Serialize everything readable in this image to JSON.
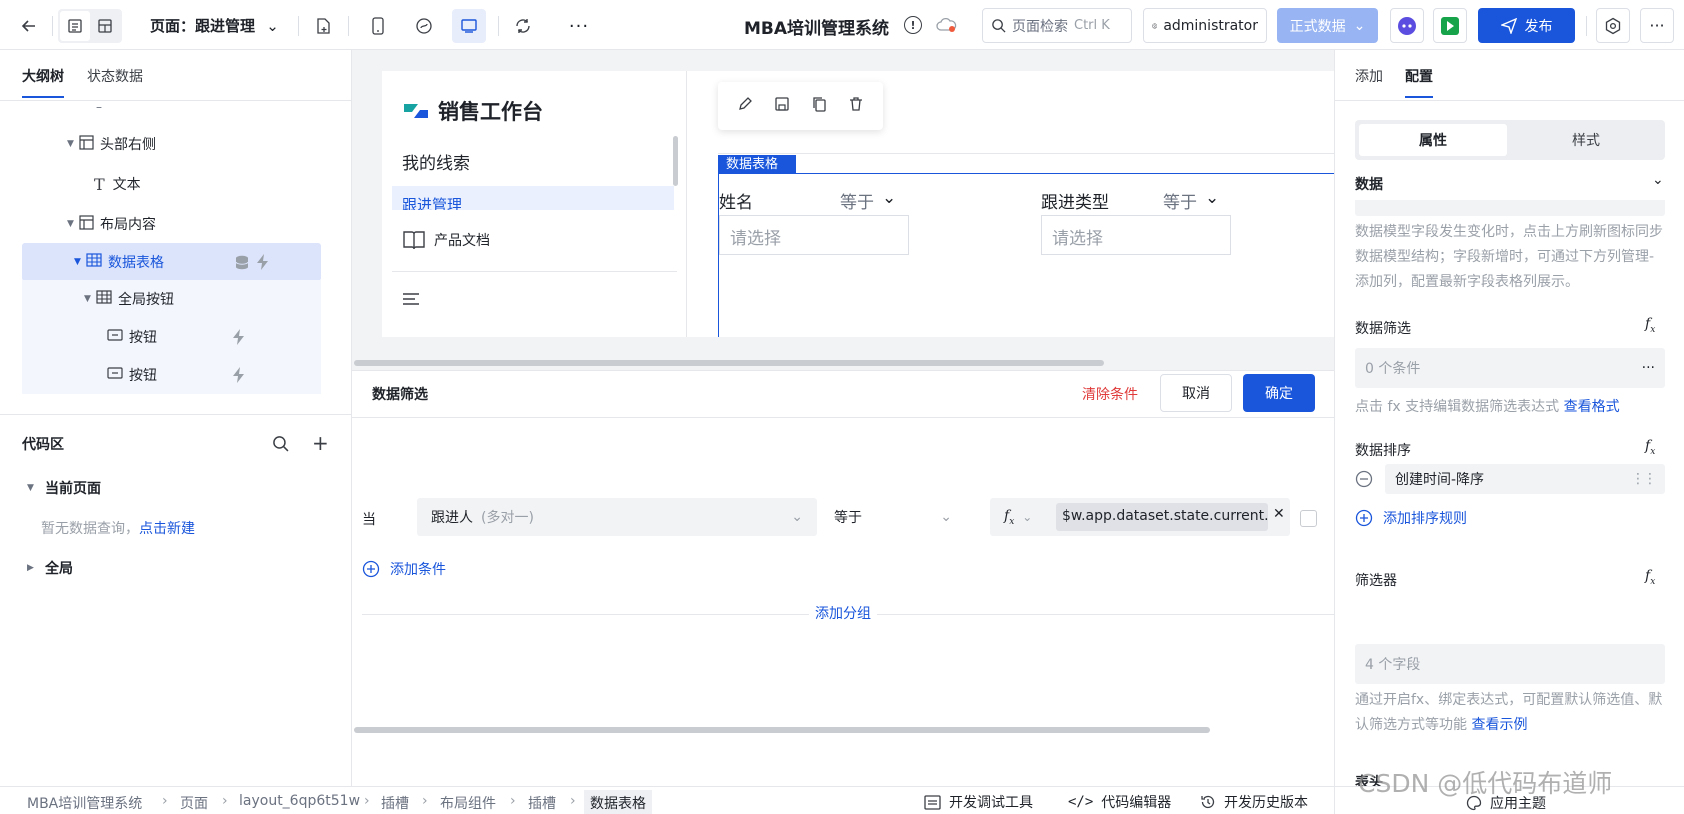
{
  "topbar": {
    "page_label": "页面：跟进管理",
    "app_title": "MBA培训管理系统",
    "search_placeholder": "页面检索",
    "search_shortcut": "Ctrl K",
    "user": "administrator",
    "env": "正式数据",
    "publish": "发布"
  },
  "left": {
    "tabs": [
      "大纲树",
      "状态数据"
    ],
    "tree_dash": "–",
    "tree": [
      "头部右侧",
      "文本",
      "布局内容",
      "数据表格",
      "全局按钮",
      "按钮",
      "按钮"
    ],
    "code_title": "代码区",
    "current_page": "当前页面",
    "empty_text": "暂无数据查询，",
    "create_link": "点击新建",
    "global": "全局"
  },
  "canvas": {
    "brand": "销售工作台",
    "menu": [
      "我的线索",
      "跟进管理",
      "产品文档"
    ],
    "table_tag": "数据表格",
    "filter1_label": "姓名",
    "filter1_op": "等于",
    "filter2_label": "跟进类型",
    "filter2_op": "等于",
    "select_placeholder": "请选择"
  },
  "filter_panel": {
    "title": "数据筛选",
    "clear": "清除条件",
    "cancel": "取消",
    "confirm": "确定",
    "when": "当",
    "field": "跟进人",
    "field_hint": "(多对一)",
    "operator": "等于",
    "fx": "fx",
    "expression": "$w.app.dataset.state.current...",
    "add_condition": "添加条件",
    "add_group": "添加分组"
  },
  "right": {
    "tabs": [
      "添加",
      "配置"
    ],
    "seg": [
      "属性",
      "样式"
    ],
    "data_title": "数据",
    "data_hint": "数据模型字段发生变化时，点击上方刷新图标同步数据模型结构；字段新增时，可通过下方列管理-添加列，配置最新字段表格列展示。",
    "filter_title": "数据筛选",
    "filter_value": "0 个条件",
    "filter_hint": "点击 fx 支持编辑数据筛选表达式",
    "filter_hint_link": "查看格式",
    "sort_title": "数据排序",
    "sort_item": "创建时间-降序",
    "add_sort": "添加排序规则",
    "selector_title": "筛选器",
    "selector_value": "4 个字段",
    "selector_hint": "通过开启fx、绑定表达式，可配置默认筛选值、默认筛选方式等功能",
    "selector_hint_link": "查看示例",
    "cut_title": "表头"
  },
  "bottom": {
    "crumbs": [
      "MBA培训管理系统",
      "页面",
      "layout_6qp6t51w",
      "插槽",
      "布局组件",
      "插槽",
      "数据表格"
    ],
    "devtools": "开发调试工具",
    "code_editor": "代码编辑器",
    "history": "开发历史版本",
    "theme": "应用主题",
    "watermark": "CSDN @低代码布道师"
  }
}
